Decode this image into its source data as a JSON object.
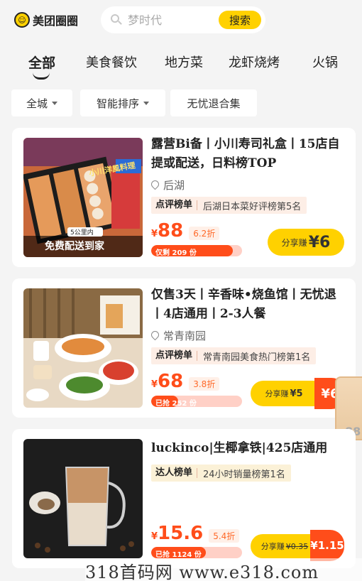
{
  "header": {
    "brand": "美团圈圈",
    "logo_glyph": "☺",
    "search_placeholder": "梦时代",
    "search_button": "搜索"
  },
  "tabs": [
    "全部",
    "美食餐饮",
    "地方菜",
    "龙虾烧烤",
    "火锅"
  ],
  "active_tab": "全部",
  "filters": [
    {
      "label": "全城",
      "has_caret": true
    },
    {
      "label": "智能排序",
      "has_caret": true
    },
    {
      "label": "无忧退合集",
      "has_caret": false
    }
  ],
  "cards": [
    {
      "title": "露营Bi备丨小川寿司礼盒丨15店自提或配送，日料榜TOP",
      "location": "后湖",
      "rank_tag": "点评榜单",
      "rank_text": "后湖日本菜好评榜第5名",
      "price_symbol": "¥",
      "price": "88",
      "discount": "6.2折",
      "sold_text": "仅剩 209 份",
      "sold_fraction": 0.9,
      "share_label": "分享赚",
      "share_amount": "¥6",
      "thumb_text_top": "小川洋風料理",
      "thumb_text_small": "5公里内",
      "thumb_text_bottom": "免费配送到家"
    },
    {
      "title": "仅售3天丨辛香味•烧鱼馆丨无忧退丨4店通用丨2-3人餐",
      "location": "常青南园",
      "rank_tag": "点评榜单",
      "rank_text": "常青南园美食热门榜第1名",
      "price_symbol": "¥",
      "price": "68",
      "discount": "3.8折",
      "sold_text": "已抢 252 份",
      "sold_fraction": 0.3,
      "share_label": "分享赚",
      "share_amount_small": "¥5",
      "share_amount": "¥6"
    },
    {
      "title": "luckinco|生椰拿铁|425店通用",
      "rank_tag": "达人榜单",
      "rank_text": "24小时销量榜第1名",
      "price_symbol": "¥",
      "price": "15.6",
      "discount": "5.4折",
      "sold_text": "已抢 1124 份",
      "sold_fraction": 0.6,
      "share_label": "分享赚",
      "share_amount_strike": "¥0.35",
      "share_amount": "¥1.15"
    }
  ],
  "side_peek": "88",
  "watermark": "318首码网  www.e318.com",
  "colors": {
    "brand_yellow": "#ffd100",
    "price_red": "#ff4d1a",
    "background": "#f4f4f4"
  }
}
